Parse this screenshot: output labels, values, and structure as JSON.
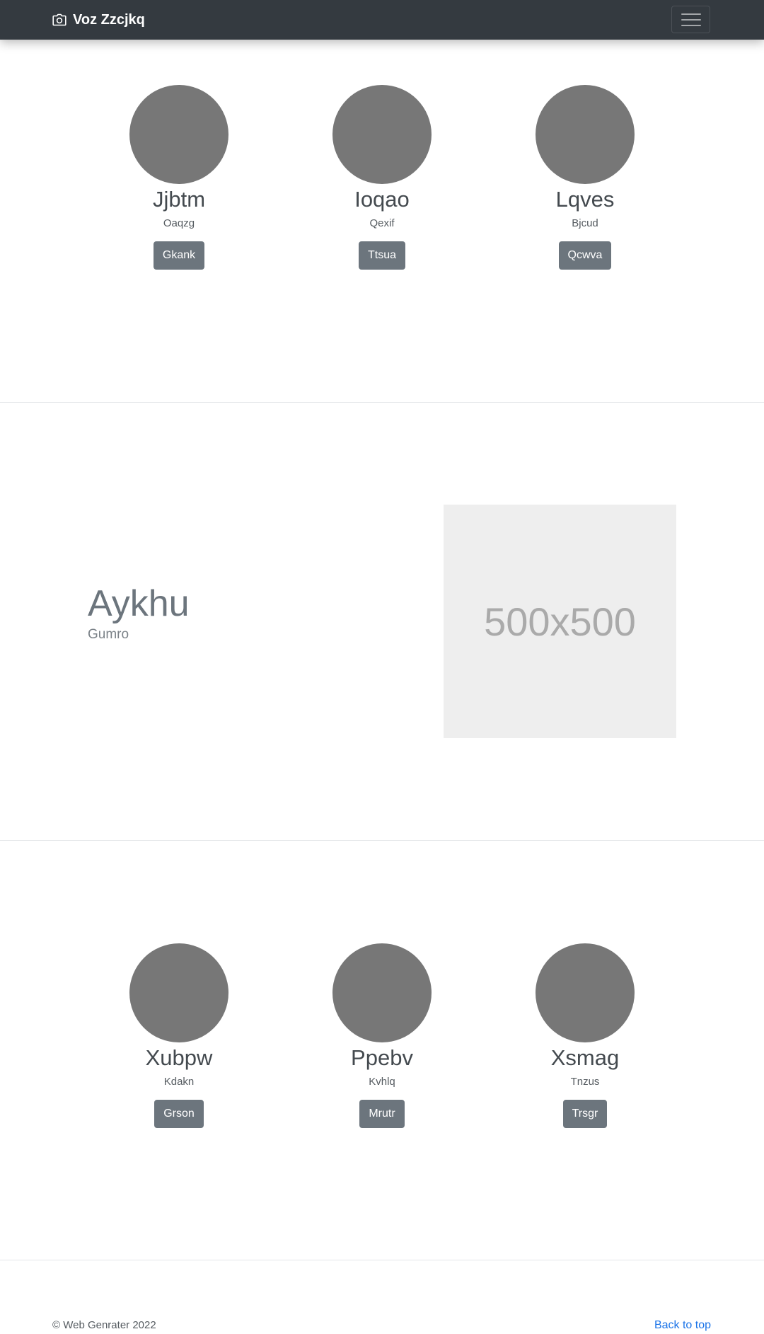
{
  "navbar": {
    "brand_icon": "camera-icon",
    "brand": "Voz Zzcjkq",
    "toggler_icon": "hamburger-icon"
  },
  "profiles_top": [
    {
      "name": "Jjbtm",
      "subtitle": "Oaqzg",
      "button": "Gkank"
    },
    {
      "name": "Ioqao",
      "subtitle": "Qexif",
      "button": "Ttsua"
    },
    {
      "name": "Lqves",
      "subtitle": "Bjcud",
      "button": "Qcwva"
    }
  ],
  "feature": {
    "title": "Aykhu",
    "subtitle": "Gumro",
    "image_label": "500x500"
  },
  "profiles_bottom": [
    {
      "name": "Xubpw",
      "subtitle": "Kdakn",
      "button": "Grson"
    },
    {
      "name": "Ppebv",
      "subtitle": "Kvhlq",
      "button": "Mrutr"
    },
    {
      "name": "Xsmag",
      "subtitle": "Tnzus",
      "button": "Trsgr"
    }
  ],
  "footer": {
    "copyright": "© Web Genrater 2022",
    "back_to_top": "Back to top"
  },
  "colors": {
    "navbar_bg": "#343a40",
    "button_bg": "#6c757d",
    "avatar_bg": "#777777",
    "link": "#1a73e8"
  }
}
